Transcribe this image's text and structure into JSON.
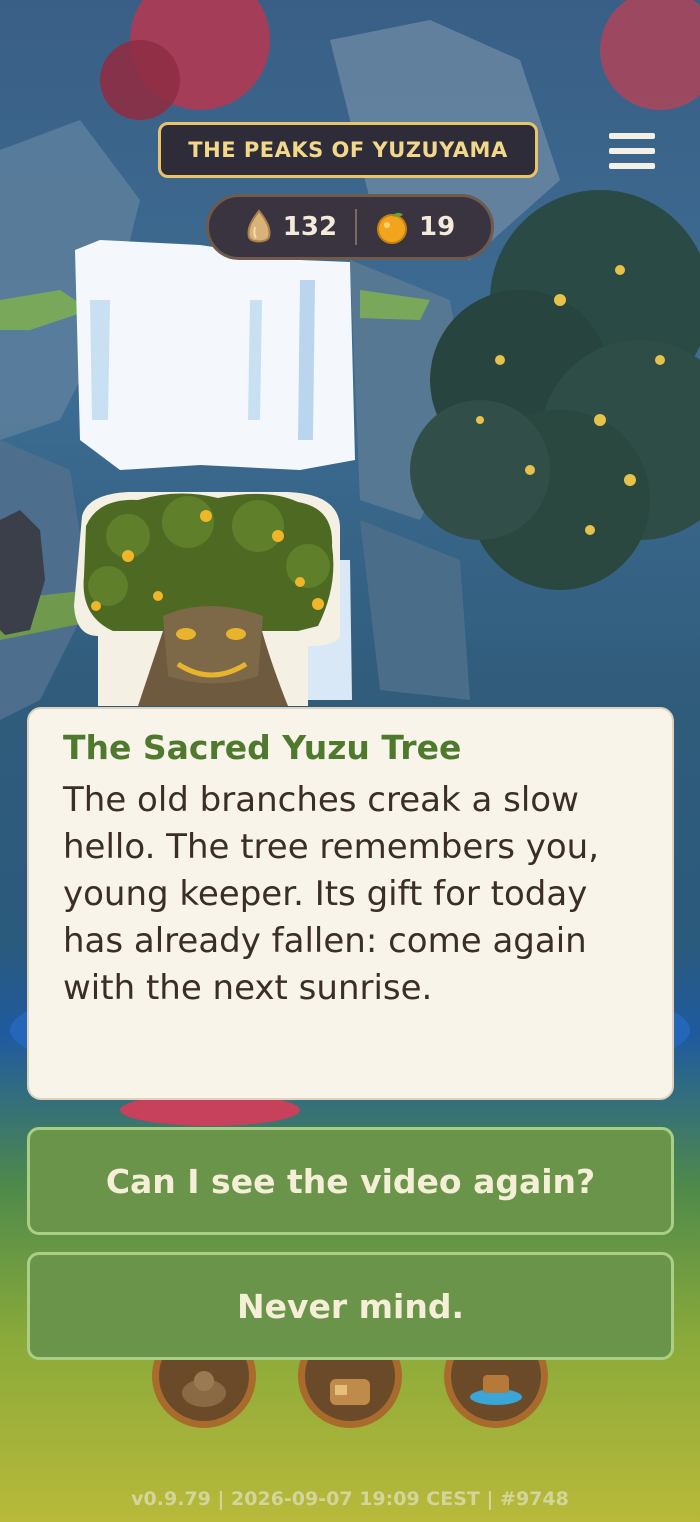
{
  "header": {
    "location_title": "THE PEAKS OF YUZUYAMA",
    "menu_icon": "hamburger-menu-icon"
  },
  "currency": {
    "seeds": {
      "icon": "seed-icon",
      "value": "132"
    },
    "yuzu": {
      "icon": "yuzu-fruit-icon",
      "value": "19"
    }
  },
  "dialog": {
    "speaker": "The Sacred Yuzu Tree",
    "text": "The old branches creak a slow hello. The tree remembers you, young keeper. Its gift for today has already fallen: come again with the next sunrise."
  },
  "choices": [
    {
      "label": "Can I see the video again?"
    },
    {
      "label": "Never mind."
    }
  ],
  "bottom_nav": [
    {
      "icon": "capybara-icon"
    },
    {
      "icon": "backpack-icon"
    },
    {
      "icon": "hot-spring-icon"
    }
  ],
  "footer": {
    "version": "v0.9.79 | 2026-09-07 19:09 CEST | #9748"
  },
  "colors": {
    "accent_gold": "#e8c56a",
    "dialog_title_green": "#4f7a2e",
    "choice_green": "#6a944a",
    "dialog_bg": "#f8f4ea"
  }
}
